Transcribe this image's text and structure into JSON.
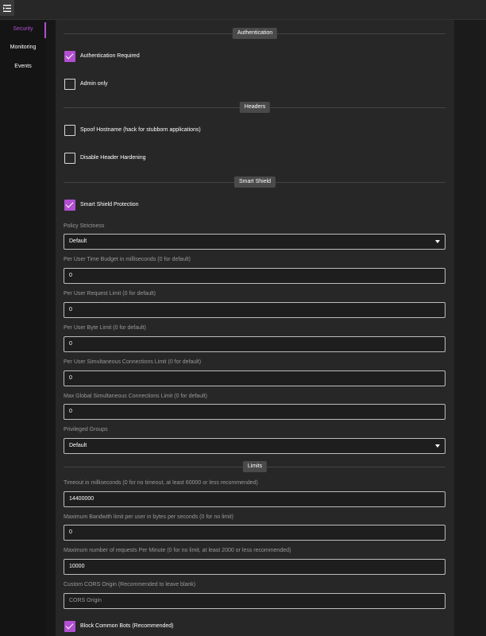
{
  "menu_icon": "hamburger-menu-icon",
  "sidebar": {
    "items": [
      {
        "label": "Security",
        "active": true
      },
      {
        "label": "Monitoring",
        "active": false
      },
      {
        "label": "Events",
        "active": false
      }
    ]
  },
  "colors": {
    "accent": "#b14fd1",
    "panel": "#272727",
    "input_bg": "#1e1e1e"
  },
  "sections": {
    "authentication": "Authentication",
    "headers": "Headers",
    "smart_shield": "Smart Shield",
    "limits": "Limits"
  },
  "checkboxes": {
    "auth_required": {
      "label": "Authentication Required",
      "checked": true
    },
    "admin_only": {
      "label": "Admin only",
      "checked": false
    },
    "spoof_hostname": {
      "label": "Spoof Hostname (hack for stubborn applications)",
      "checked": false
    },
    "disable_header_hardening": {
      "label": "Disable Header Hardening",
      "checked": false
    },
    "smart_shield_protection": {
      "label": "Smart Shield Protection",
      "checked": true
    },
    "block_common_bots": {
      "label": "Block Common Bots (Recommended)",
      "checked": true
    }
  },
  "fields": {
    "policy_strictness": {
      "label": "Policy Strictness",
      "value": "Default"
    },
    "time_budget": {
      "label": "Per User Time Budget in milliseconds (0 for default)",
      "value": "0"
    },
    "request_limit": {
      "label": "Per User Request Limit (0 for default)",
      "value": "0"
    },
    "byte_limit": {
      "label": "Per User Byte Limit (0 for default)",
      "value": "0"
    },
    "simultaneous_limit": {
      "label": "Per User Simultaneous Connections Limit (0 for default)",
      "value": "0"
    },
    "global_limit": {
      "label": "Max Global Simultaneous Connections Limit (0 for default)",
      "value": "0"
    },
    "privileged_groups": {
      "label": "Privileged Groups",
      "value": "Default"
    },
    "timeout": {
      "label": "Timeout in milliseconds (0 for no timeout, at least 60000 or less recommended)",
      "value": "14400000"
    },
    "bandwidth": {
      "label": "Maximum Bandwith limit per user in bytes per seconds (0 for no limit)",
      "value": "0"
    },
    "requests_per_minute": {
      "label": "Maximum number of requests Per Minute (0 for no limit, at least 2000 or less recommended)",
      "value": "10000"
    },
    "cors_origin": {
      "label": "Custom CORS Origin (Recommended to leave blank)",
      "value": "",
      "placeholder": "CORS Origin"
    }
  }
}
